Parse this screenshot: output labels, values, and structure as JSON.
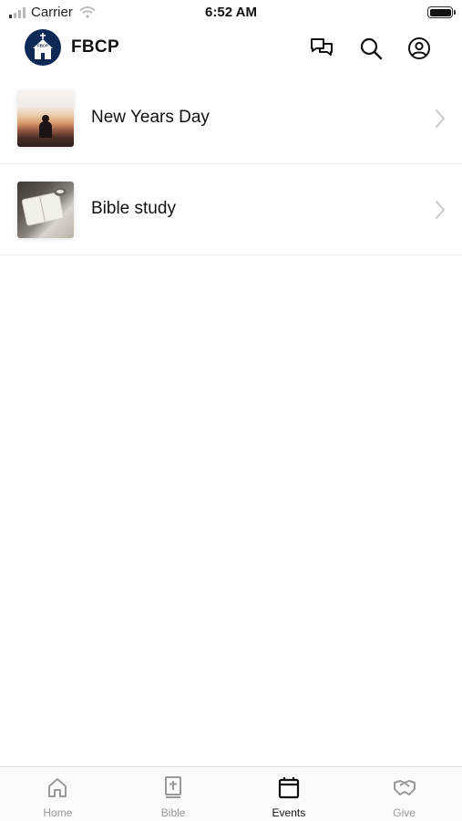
{
  "status_bar": {
    "carrier": "Carrier",
    "time": "6:52 AM"
  },
  "header": {
    "title": "FBCP",
    "logo_text": "FBCP",
    "icons": [
      "chat-bubbles-icon",
      "search-icon",
      "profile-icon"
    ]
  },
  "events": [
    {
      "title": "New Years Day",
      "thumbnail": "sunset-silhouette"
    },
    {
      "title": "Bible study",
      "thumbnail": "open-bible-with-coffee"
    }
  ],
  "tabs": [
    {
      "label": "Home",
      "icon": "home-icon",
      "active": false
    },
    {
      "label": "Bible",
      "icon": "bible-icon",
      "active": false
    },
    {
      "label": "Events",
      "icon": "calendar-icon",
      "active": true
    },
    {
      "label": "Give",
      "icon": "handshake-icon",
      "active": false
    }
  ],
  "colors": {
    "brand_navy": "#0d2a57",
    "active_tab": "#111111",
    "inactive_tab": "#9a9a9a"
  }
}
